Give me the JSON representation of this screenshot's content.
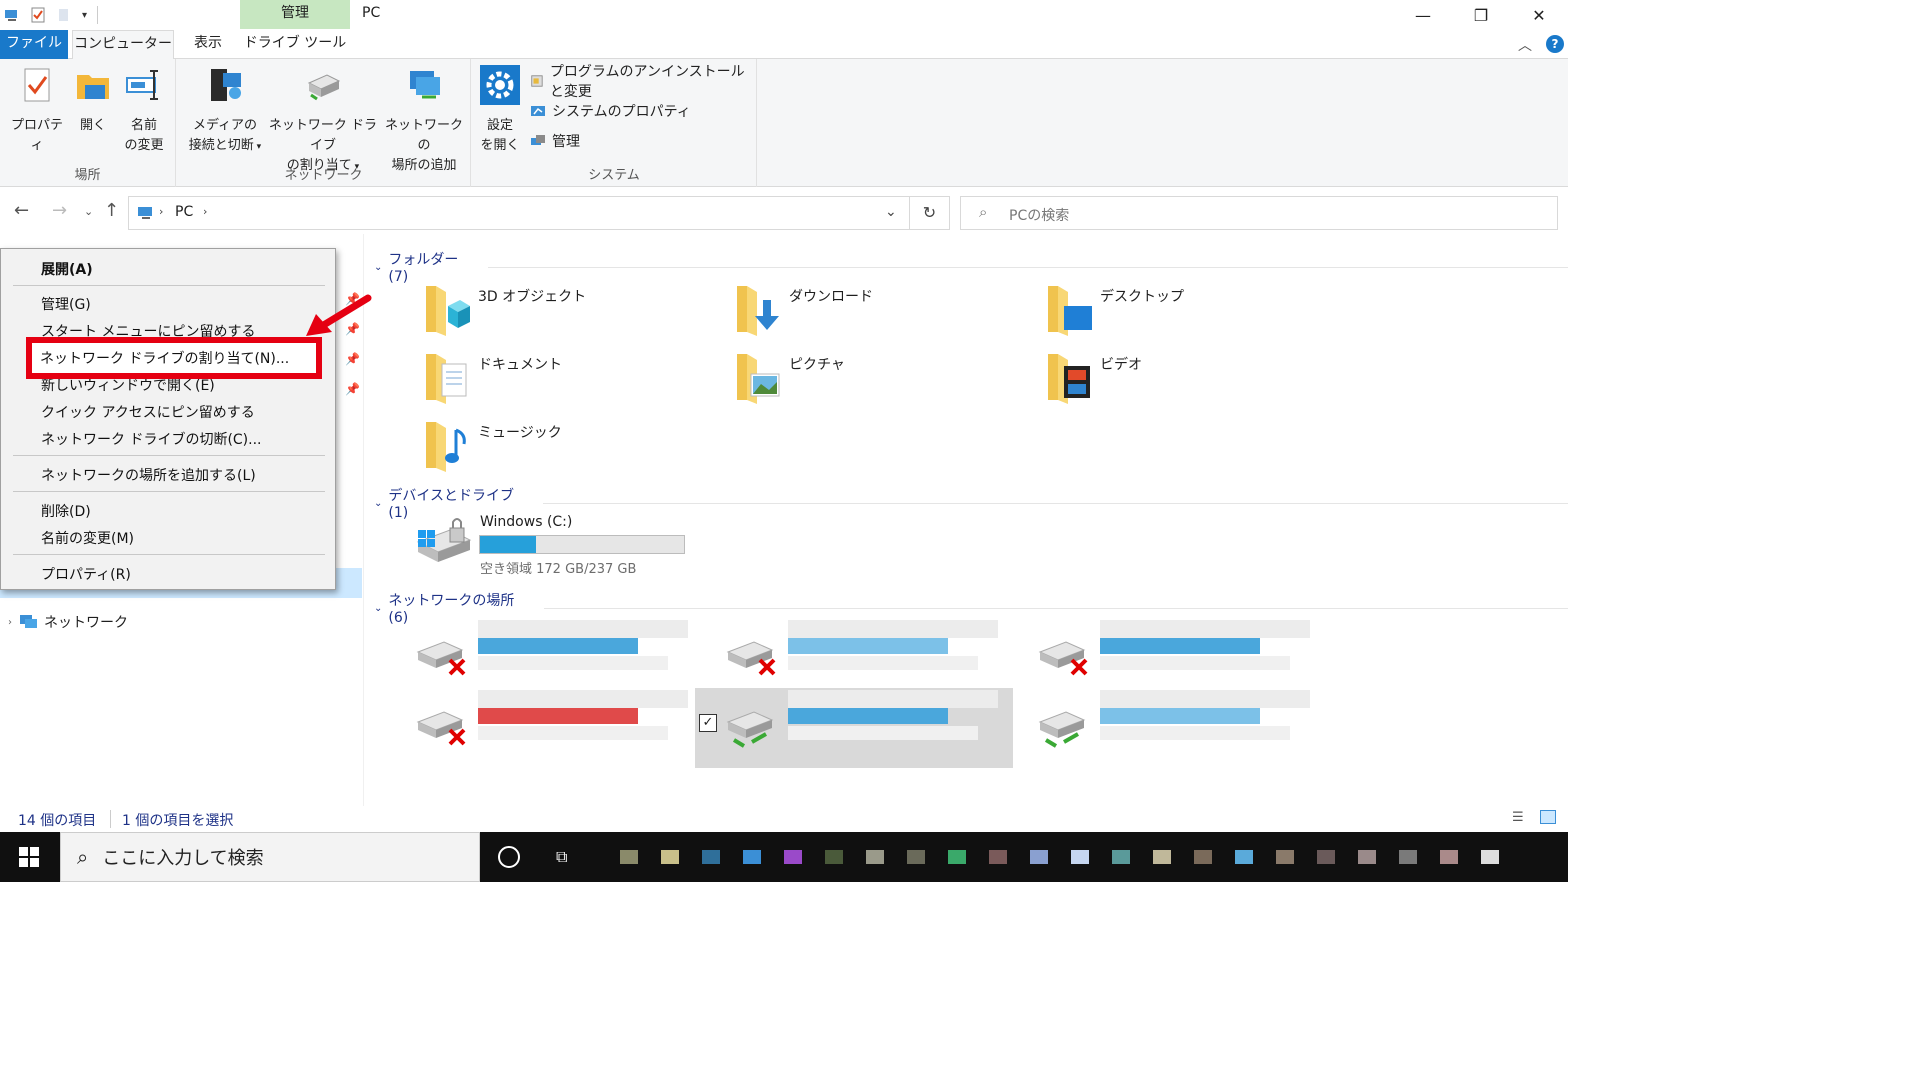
{
  "window": {
    "title": "PC",
    "manage_tab_head": "管理",
    "controls": {
      "minimize": "—",
      "maximize": "❐",
      "close": "✕"
    }
  },
  "ribbon_tabs": {
    "file": "ファイル",
    "computer": "コンピューター",
    "view": "表示",
    "drive_tools": "ドライブ ツール",
    "help": "?"
  },
  "ribbon": {
    "location_group": {
      "label": "場所",
      "properties": "プロパティ",
      "open": "開く",
      "rename_1": "名前",
      "rename_2": "の変更"
    },
    "network_group": {
      "label": "ネットワーク",
      "media_1": "メディアの",
      "media_2": "接続と切断",
      "map_drive_1": "ネットワーク ドライブ",
      "map_drive_2": "の割り当て",
      "add_location_1": "ネットワークの",
      "add_location_2": "場所の追加"
    },
    "system_group": {
      "label": "システム",
      "settings_1": "設定",
      "settings_2": "を開く",
      "uninstall": "プログラムのアンインストールと変更",
      "system_properties": "システムのプロパティ",
      "manage": "管理"
    }
  },
  "nav": {
    "path_root": "PC",
    "search_placeholder": "PCの検索"
  },
  "left_pane": {
    "network": "ネットワーク"
  },
  "context_menu": {
    "expand": "展開(A)",
    "manage": "管理(G)",
    "pin_start": "スタート メニューにピン留めする",
    "map_drive": "ネットワーク ドライブの割り当て(N)...",
    "open_new_window": "新しいウィンドウで開く(E)",
    "pin_quick": "クイック アクセスにピン留めする",
    "disconnect_drive": "ネットワーク ドライブの切断(C)...",
    "add_network_location": "ネットワークの場所を追加する(L)",
    "delete": "削除(D)",
    "rename": "名前の変更(M)",
    "properties": "プロパティ(R)"
  },
  "content": {
    "folders_header": "フォルダー (7)",
    "folders": [
      "3D オブジェクト",
      "ダウンロード",
      "デスクトップ",
      "ドキュメント",
      "ピクチャ",
      "ビデオ",
      "ミュージック"
    ],
    "devices_header": "デバイスとドライブ (1)",
    "drive": {
      "name": "Windows  (C:)",
      "free_text": "空き領域 172 GB/237 GB",
      "used_fraction": 0.274
    },
    "network_header": "ネットワークの場所 (6)"
  },
  "status": {
    "item_count": "14 個の項目",
    "selected": "1 個の項目を選択"
  },
  "taskbar": {
    "search": "ここに入力して検索"
  }
}
